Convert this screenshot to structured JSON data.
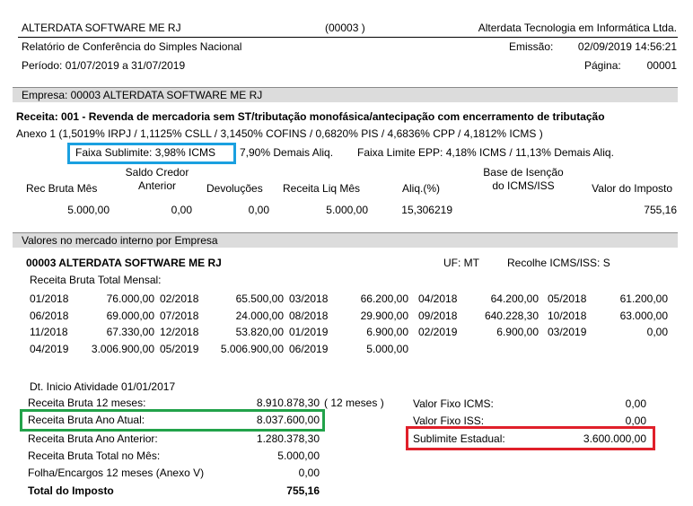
{
  "header": {
    "company": "ALTERDATA SOFTWARE ME RJ",
    "code": "(00003 )",
    "vendor": "Alterdata Tecnologia em Informática Ltda.",
    "report_title": "Relatório de Conferência do Simples Nacional",
    "emission_label": "Emissão:",
    "emission_value": "02/09/2019 14:56:21",
    "period": "Período:  01/07/2019 a 31/07/2019",
    "page_label": "Página:",
    "page_value": "00001"
  },
  "empresa_band": "Empresa:  00003 ALTERDATA SOFTWARE ME RJ",
  "receita": {
    "title": "Receita:  001 - Revenda de mercadoria sem ST/tributação monofásica/antecipação com encerramento de tributação",
    "anexo": "Anexo    1  (1,5019% IRPJ  / 1,1125% CSLL / 3,1450% COFINS / 0,6820% PIS  / 4,6836% CPP / 4,1812% ICMS )",
    "faixa_sublimite": "Faixa Sublimite: 3,98% ICMS",
    "demais_aliq": "7,90% Demais Aliq.",
    "faixa_limite": "Faixa Limite EPP: 4,18% ICMS / 11,13% Demais Aliq.",
    "columns": {
      "rec_bruta": "Rec Bruta Mês",
      "saldo_l1": "Saldo Credor",
      "saldo_l2": "Anterior",
      "devolucoes": "Devoluções",
      "receita_liq": "Receita Liq Mês",
      "aliq": "Aliq.(%)",
      "base_l1": "Base de Isenção",
      "base_l2": "do ICMS/ISS",
      "valor_imposto": "Valor do Imposto"
    },
    "values": {
      "rec_bruta": "5.000,00",
      "saldo": "0,00",
      "devolucoes": "0,00",
      "receita_liq": "5.000,00",
      "aliq": "15,306219",
      "valor_imposto": "755,16"
    }
  },
  "mercado_band": "Valores no mercado interno por Empresa",
  "mercado": {
    "company": "00003  ALTERDATA SOFTWARE ME RJ",
    "uf": "UF: MT",
    "recolhe": "Recolhe ICMS/ISS:  S",
    "receita_mensal_label": "Receita Bruta Total Mensal:",
    "months": [
      [
        [
          "01/2018",
          "76.000,00"
        ],
        [
          "02/2018",
          "65.500,00"
        ],
        [
          "03/2018",
          "66.200,00"
        ],
        [
          "04/2018",
          "64.200,00"
        ],
        [
          "05/2018",
          "61.200,00"
        ]
      ],
      [
        [
          "06/2018",
          "69.000,00"
        ],
        [
          "07/2018",
          "24.000,00"
        ],
        [
          "08/2018",
          "29.900,00"
        ],
        [
          "09/2018",
          "640.228,30"
        ],
        [
          "10/2018",
          "63.000,00"
        ]
      ],
      [
        [
          "11/2018",
          "67.330,00"
        ],
        [
          "12/2018",
          "53.820,00"
        ],
        [
          "01/2019",
          "6.900,00"
        ],
        [
          "02/2019",
          "6.900,00"
        ],
        [
          "03/2019",
          "0,00"
        ]
      ],
      [
        [
          "04/2019",
          "3.006.900,00"
        ],
        [
          "05/2019",
          "5.006.900,00"
        ],
        [
          "06/2019",
          "5.000,00"
        ]
      ]
    ],
    "dt_inicio": "Dt. Inicio Atividade   01/01/2017",
    "summary": [
      {
        "label": "Receita Bruta 12 meses:",
        "value": "8.910.878,30",
        "extra": "( 12  meses )"
      },
      {
        "label": "Receita Bruta Ano Atual:",
        "value": "8.037.600,00"
      },
      {
        "label": "Receita Bruta Ano Anterior:",
        "value": "1.280.378,30"
      },
      {
        "label": "Receita Bruta Total no Mês:",
        "value": "5.000,00"
      },
      {
        "label": "Folha/Encargos 12 meses (Anexo V)",
        "value": "0,00"
      }
    ],
    "total_label": "Total do Imposto",
    "total_value": "755,16",
    "fixos": [
      {
        "label": "Valor Fixo ICMS:",
        "value": "0,00"
      },
      {
        "label": "Valor Fixo ISS:",
        "value": "0,00"
      },
      {
        "label": "Sublimite Estadual:",
        "value": "3.600.000,00"
      }
    ]
  },
  "colors": {
    "highlight_blue": "#1aa0e0",
    "highlight_green": "#22a24a",
    "highlight_red": "#e0202a",
    "band_gray": "#dcdcdc"
  }
}
